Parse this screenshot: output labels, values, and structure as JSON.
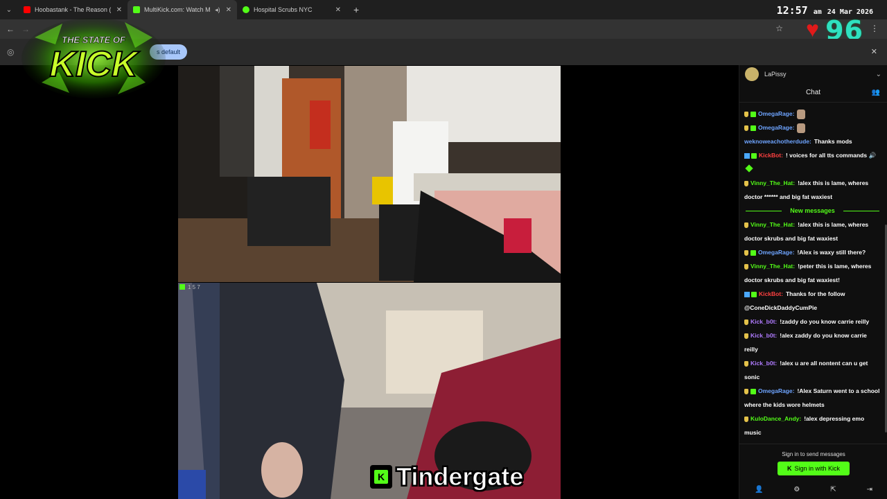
{
  "colors": {
    "kick_green": "#53fc18",
    "heart_red": "#e01a1a",
    "counter_teal": "#2fe0c0"
  },
  "browser": {
    "tabs": [
      {
        "title": "Hoobastank - The Reason (Lyric",
        "icon": "youtube-icon",
        "color": "#ff0000"
      },
      {
        "title": "MultiKick.com: Watch Multi",
        "icon": "multikick-icon",
        "color": "#53fc18"
      },
      {
        "title": "Hospital Scrubs NYC",
        "icon": "play-icon",
        "color": "#53fc18"
      }
    ],
    "new_tab": "+",
    "infobar_button": "s default"
  },
  "clock": {
    "time": "12:57",
    "ampm": "am",
    "date": "24 Mar 2026"
  },
  "overlay": {
    "counter": "96"
  },
  "logo": {
    "line1": "THE STATE OF",
    "line2": "KICK"
  },
  "videos": {
    "bottom_label": "1 5 7"
  },
  "caption": {
    "text": "Tindergate",
    "k": "K"
  },
  "chat": {
    "channel_user": "LaPissy",
    "header": "Chat",
    "new_messages": "New messages",
    "messages": [
      {
        "user": "OmegaRage",
        "color": "#6ea4ff",
        "text": "",
        "badges": [
          "gift",
          "sub"
        ],
        "emote": true
      },
      {
        "user": "OmegaRage",
        "color": "#6ea4ff",
        "text": "",
        "badges": [
          "gift",
          "sub"
        ],
        "emote": true
      },
      {
        "user": "weknoweachotherdude",
        "color": "#6ea4ff",
        "text": "Thanks mods",
        "badges": []
      },
      {
        "user": "KickBot",
        "color": "#ff4040",
        "text": "! voices for all tts commands 🔊",
        "badges": [
          "verified",
          "bot"
        ],
        "heart": true
      },
      {
        "user": "Vinny_The_Hat",
        "color": "#53fc18",
        "text": "!alex this is lame, wheres doctor ****** and big fat waxiest",
        "badges": [
          "gift"
        ]
      },
      {
        "divider": true
      },
      {
        "user": "Vinny_The_Hat",
        "color": "#53fc18",
        "text": "!alex this is lame, wheres doctor skrubs and big fat waxiest",
        "badges": [
          "gift"
        ]
      },
      {
        "user": "OmegaRage",
        "color": "#6ea4ff",
        "text": "!Alex is waxy still there?",
        "badges": [
          "gift",
          "sub"
        ]
      },
      {
        "user": "Vinny_The_Hat",
        "color": "#53fc18",
        "text": "!peter this is lame, wheres doctor skrubs and big fat waxiest!",
        "badges": [
          "gift"
        ]
      },
      {
        "user": "KickBot",
        "color": "#ff4040",
        "text": "Thanks for the follow @ConeDickDaddyCumPie",
        "badges": [
          "verified",
          "bot"
        ]
      },
      {
        "user": "Kick_b0t",
        "color": "#b07bff",
        "text": "!zaddy do you know carrie reilly",
        "badges": [
          "gift"
        ]
      },
      {
        "user": "Kick_b0t",
        "color": "#b07bff",
        "text": "!alex zaddy do you know carrie reilly",
        "badges": [
          "gift"
        ]
      },
      {
        "user": "Kick_b0t",
        "color": "#b07bff",
        "text": "!alex u are all nontent can u get sonic",
        "badges": [
          "gift"
        ]
      },
      {
        "user": "OmegaRage",
        "color": "#6ea4ff",
        "text": "!Alex Saturn went to a school where the kids wore helmets",
        "badges": [
          "gift",
          "sub"
        ]
      },
      {
        "user": "KuloDance_Andy",
        "color": "#53fc18",
        "text": "!alex depressing emo music",
        "badges": [
          "gift"
        ]
      }
    ],
    "signin_prompt": "Sign in to send messages",
    "signin_button": "Sign in with Kick"
  }
}
